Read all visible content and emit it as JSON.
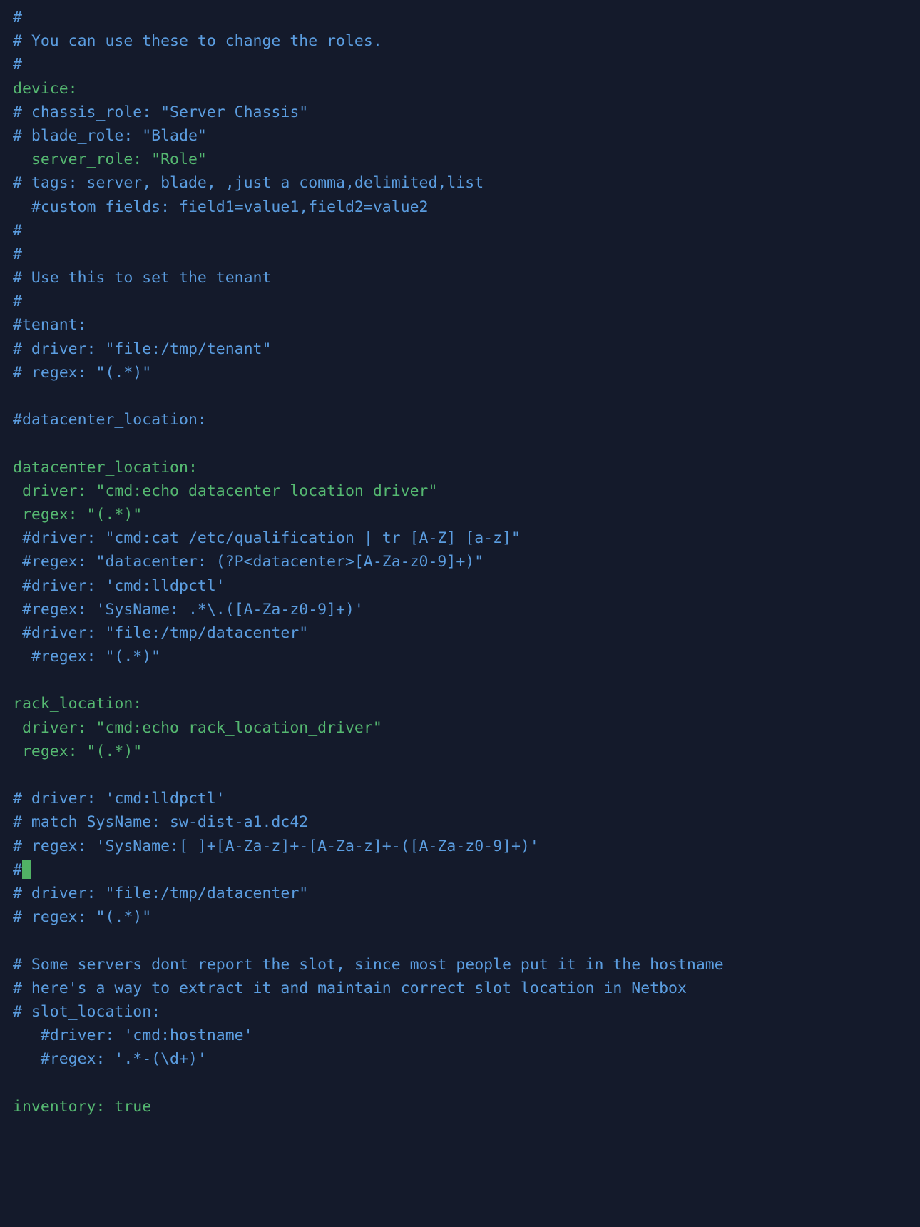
{
  "editor": {
    "app": "text-editor",
    "background_color": "#141a2b",
    "comment_color": "#5b9de0",
    "key_color": "#55b871",
    "cursor_color": "#51b265",
    "cursor_line_index": 41,
    "cursor_column": 1,
    "lines": [
      {
        "text": "#",
        "type": "comment"
      },
      {
        "text": "# You can use these to change the roles.",
        "type": "comment"
      },
      {
        "text": "#",
        "type": "comment"
      },
      {
        "text": "device:",
        "type": "key"
      },
      {
        "text": "# chassis_role: \"Server Chassis\"",
        "type": "comment"
      },
      {
        "text": "# blade_role: \"Blade\"",
        "type": "comment"
      },
      {
        "text": "  server_role: \"Role\"",
        "type": "key"
      },
      {
        "text": "# tags: server, blade, ,just a comma,delimited,list",
        "type": "comment"
      },
      {
        "text": "  #custom_fields: field1=value1,field2=value2",
        "type": "comment"
      },
      {
        "text": "#",
        "type": "comment"
      },
      {
        "text": "#",
        "type": "comment"
      },
      {
        "text": "# Use this to set the tenant",
        "type": "comment"
      },
      {
        "text": "#",
        "type": "comment"
      },
      {
        "text": "#tenant:",
        "type": "comment"
      },
      {
        "text": "# driver: \"file:/tmp/tenant\"",
        "type": "comment"
      },
      {
        "text": "# regex: \"(.*)\"",
        "type": "comment"
      },
      {
        "text": "",
        "type": "blank"
      },
      {
        "text": "#datacenter_location:",
        "type": "comment"
      },
      {
        "text": "",
        "type": "blank"
      },
      {
        "text": "datacenter_location:",
        "type": "key"
      },
      {
        "text": " driver: \"cmd:echo datacenter_location_driver\"",
        "type": "key"
      },
      {
        "text": " regex: \"(.*)\"",
        "type": "key"
      },
      {
        "text": " #driver: \"cmd:cat /etc/qualification | tr [A-Z] [a-z]\"",
        "type": "comment"
      },
      {
        "text": " #regex: \"datacenter: (?P<datacenter>[A-Za-z0-9]+)\"",
        "type": "comment"
      },
      {
        "text": " #driver: 'cmd:lldpctl'",
        "type": "comment"
      },
      {
        "text": " #regex: 'SysName: .*\\.([A-Za-z0-9]+)'",
        "type": "comment"
      },
      {
        "text": " #driver: \"file:/tmp/datacenter\"",
        "type": "comment"
      },
      {
        "text": "  #regex: \"(.*)\"",
        "type": "comment"
      },
      {
        "text": "",
        "type": "blank"
      },
      {
        "text": "rack_location:",
        "type": "key"
      },
      {
        "text": " driver: \"cmd:echo rack_location_driver\"",
        "type": "key"
      },
      {
        "text": " regex: \"(.*)\"",
        "type": "key"
      },
      {
        "text": "",
        "type": "blank"
      },
      {
        "text": "# driver: 'cmd:lldpctl'",
        "type": "comment"
      },
      {
        "text": "# match SysName: sw-dist-a1.dc42",
        "type": "comment"
      },
      {
        "text": "# regex: 'SysName:[ ]+[A-Za-z]+-[A-Za-z]+-([A-Za-z0-9]+)'",
        "type": "comment"
      },
      {
        "text": "#",
        "type": "comment",
        "cursor": true
      },
      {
        "text": "# driver: \"file:/tmp/datacenter\"",
        "type": "comment"
      },
      {
        "text": "# regex: \"(.*)\"",
        "type": "comment"
      },
      {
        "text": "",
        "type": "blank"
      },
      {
        "text": "# Some servers dont report the slot, since most people put it in the hostname",
        "type": "comment"
      },
      {
        "text": "# here's a way to extract it and maintain correct slot location in Netbox",
        "type": "comment"
      },
      {
        "text": "# slot_location:",
        "type": "comment"
      },
      {
        "text": "   #driver: 'cmd:hostname'",
        "type": "comment"
      },
      {
        "text": "   #regex: '.*-(\\d+)'",
        "type": "comment"
      },
      {
        "text": "",
        "type": "blank"
      },
      {
        "text": "inventory: true",
        "type": "key"
      }
    ]
  }
}
